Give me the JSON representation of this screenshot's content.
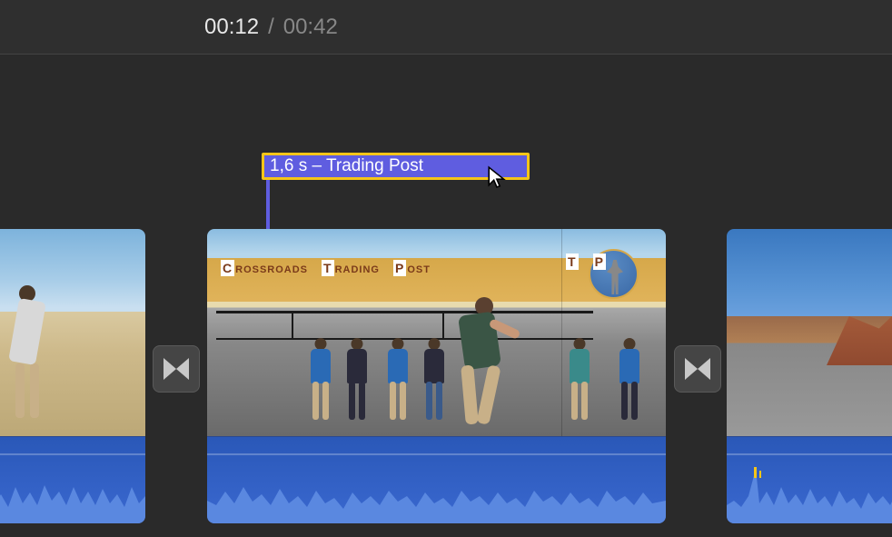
{
  "header": {
    "current_time": "00:12",
    "separator": "/",
    "total_time": "00:42"
  },
  "title_clip": {
    "label": "1,6 s – Trading Post"
  },
  "sign": {
    "word1": "CROSSROADS",
    "word2": "TRADING",
    "word3": "POST",
    "word4": "T",
    "word5": "P"
  },
  "icons": {
    "cursor": "cursor-arrow-icon",
    "transition": "bowtie-transition-icon"
  }
}
